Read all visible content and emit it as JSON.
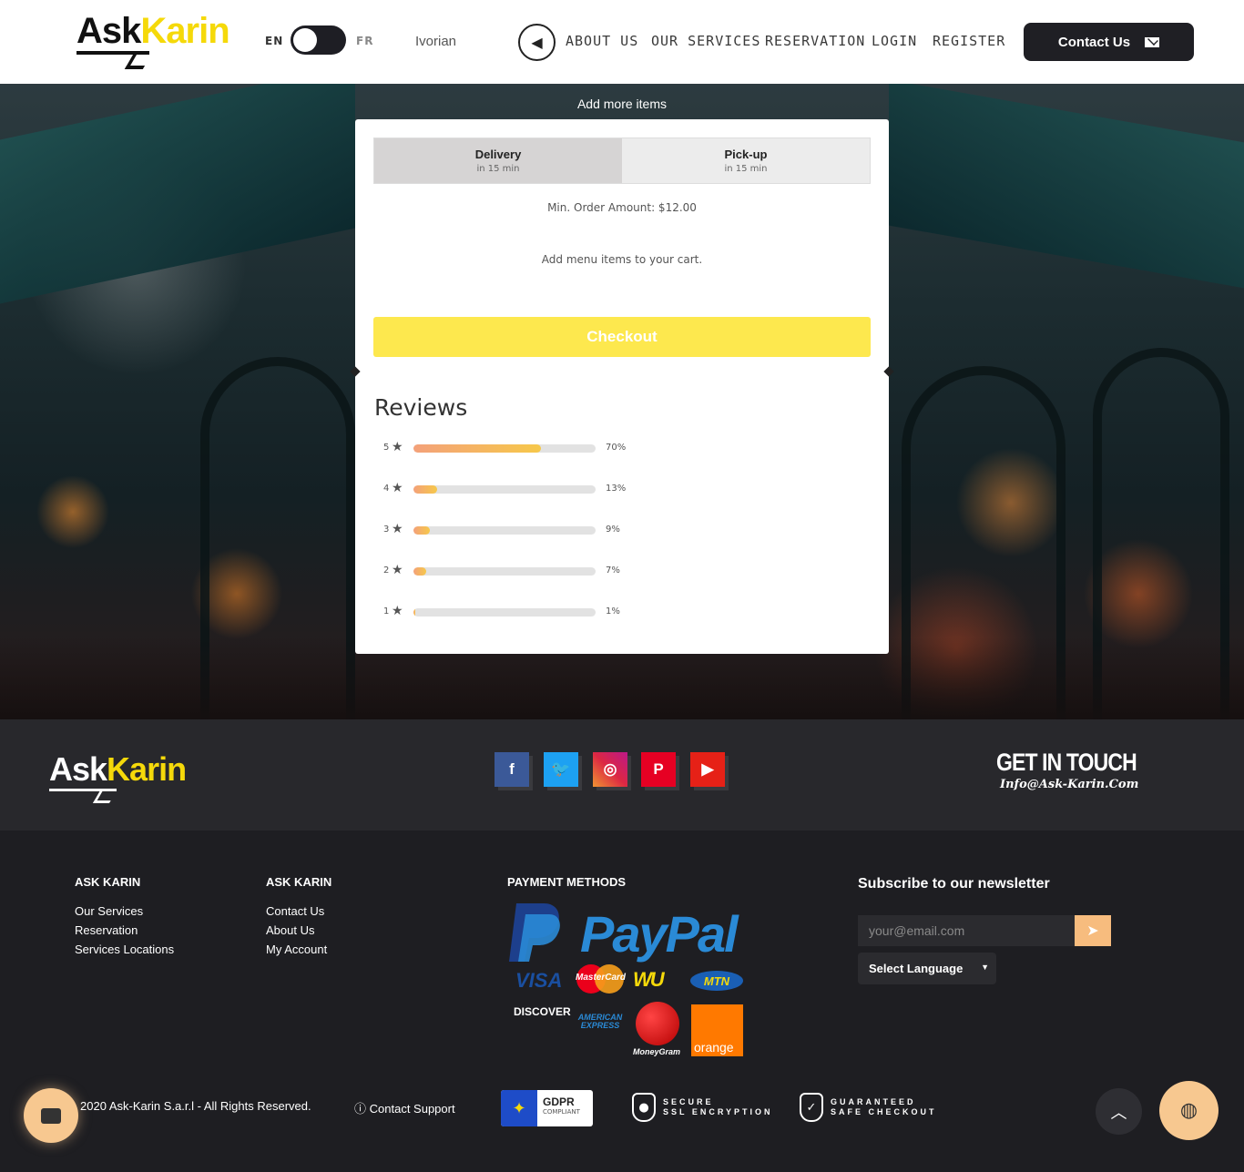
{
  "header": {
    "logo": {
      "ask": "Ask",
      "karin": "Karin"
    },
    "lang_en": "EN",
    "lang_fr": "FR",
    "region": "Ivorian",
    "nav": [
      "ABOUT US",
      "OUR SERVICES",
      "RESERVATION",
      "LOGIN",
      "REGISTER"
    ],
    "contact_label": "Contact Us"
  },
  "hero": {
    "add_more": "Add more items"
  },
  "order": {
    "tabs": [
      {
        "title": "Delivery",
        "sub": "in 15 min",
        "active": true
      },
      {
        "title": "Pick-up",
        "sub": "in 15 min",
        "active": false
      }
    ],
    "min_order": "Min. Order Amount: $12.00",
    "empty_cart": "Add menu items to your cart.",
    "checkout_label": "Checkout"
  },
  "reviews": {
    "title": "Reviews",
    "rows": [
      {
        "stars": "5",
        "pct": "70%",
        "value": 70
      },
      {
        "stars": "4",
        "pct": "13%",
        "value": 13
      },
      {
        "stars": "3",
        "pct": "9%",
        "value": 9
      },
      {
        "stars": "2",
        "pct": "7%",
        "value": 7
      },
      {
        "stars": "1",
        "pct": "1%",
        "value": 1
      }
    ]
  },
  "footer": {
    "logo": {
      "ask": "Ask",
      "karin": "Karin"
    },
    "social": [
      {
        "name": "facebook-icon",
        "glyph": "f",
        "color": "#3b5998"
      },
      {
        "name": "twitter-icon",
        "glyph": "t",
        "color": "#1da1f2"
      },
      {
        "name": "instagram-icon",
        "glyph": "◎",
        "color": "#c13584"
      },
      {
        "name": "pinterest-icon",
        "glyph": "P",
        "color": "#e60023"
      },
      {
        "name": "youtube-icon",
        "glyph": "▶",
        "color": "#e62117"
      }
    ],
    "get_in_touch": "GET IN TOUCH",
    "email": "Info@Ask-Karin.Com",
    "col1": {
      "head": "ASK KARIN",
      "links": [
        "Our Services",
        "Reservation",
        "Services Locations"
      ]
    },
    "col2": {
      "head": "ASK KARIN",
      "links": [
        "Contact Us",
        "About Us",
        "My Account"
      ]
    },
    "payment_head": "PAYMENT METHODS",
    "payment": {
      "paypal": "PayPal",
      "visa": "VISA",
      "mastercard": "MasterCard",
      "wu": "WU",
      "mtn": "MTN",
      "discover": "DISCOVER",
      "amex": "AMERICAN EXPRESS",
      "moneygram": "MoneyGram",
      "orange": "orange"
    },
    "newsletter_title": "Subscribe to our newsletter",
    "email_placeholder": "your@email.com",
    "language_select": "Select Language",
    "copyright": "2020 Ask-Karin S.a.r.l - All Rights Reserved.",
    "support": "Contact Support",
    "gdpr_main": "GDPR",
    "gdpr_sub": "COMPLIANT",
    "ssl": [
      "SECURE",
      "SSL ENCRYPTION"
    ],
    "safe": [
      "GUARANTEED",
      "SAFE CHECKOUT"
    ]
  },
  "colors": {
    "accent": "#f5d90a",
    "checkout": "#fde84e",
    "dark": "#1e1e22",
    "orange_btn": "#f7c890"
  }
}
